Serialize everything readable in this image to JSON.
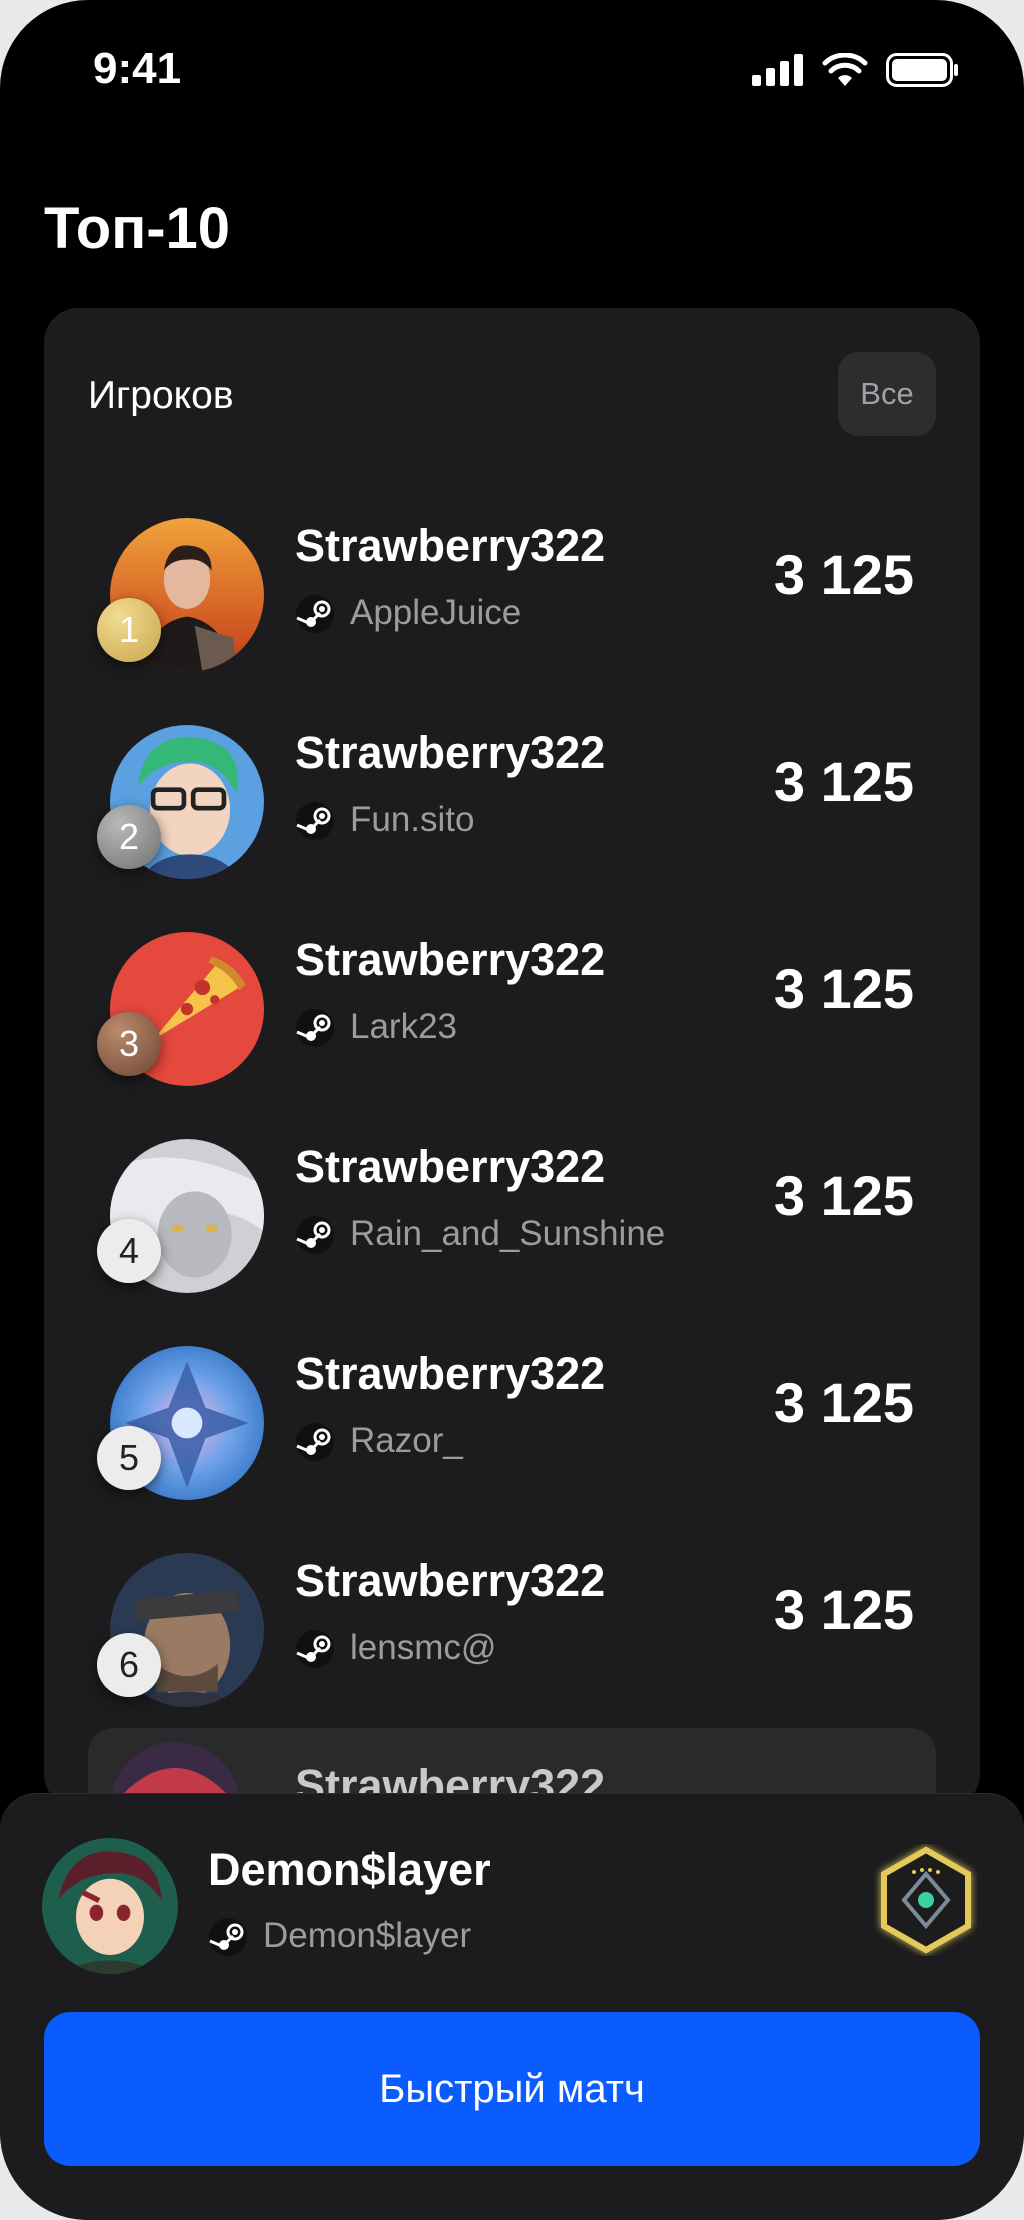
{
  "status_bar": {
    "time": "9:41",
    "icons": [
      "signal-icon",
      "wifi-icon",
      "battery-icon"
    ]
  },
  "header": {
    "title": "Топ-10"
  },
  "leaderboard": {
    "section_label": "Игроков",
    "filter_label": "Все",
    "players": [
      {
        "rank": "1",
        "name": "Strawberry322",
        "steam_name": "AppleJuice",
        "score": "3 125"
      },
      {
        "rank": "2",
        "name": "Strawberry322",
        "steam_name": "Fun.sito",
        "score": "3 125"
      },
      {
        "rank": "3",
        "name": "Strawberry322",
        "steam_name": "Lark23",
        "score": "3 125"
      },
      {
        "rank": "4",
        "name": "Strawberry322",
        "steam_name": "Rain_and_Sunshine",
        "score": "3 125"
      },
      {
        "rank": "5",
        "name": "Strawberry322",
        "steam_name": "Razor_",
        "score": "3 125"
      },
      {
        "rank": "6",
        "name": "Strawberry322",
        "steam_name": "lensmc@",
        "score": "3 125"
      }
    ],
    "partial_row": {
      "name": "Strawberry322"
    }
  },
  "current_user": {
    "name": "Demon$layer",
    "steam_name": "Demon$layer",
    "badge_icon": "rank-hexagon-icon"
  },
  "actions": {
    "quick_match_label": "Быстрый матч"
  },
  "colors": {
    "background": "#000000",
    "card": "#1c1c1e",
    "accent": "#0a5cff",
    "gold": "#d4b24e"
  }
}
